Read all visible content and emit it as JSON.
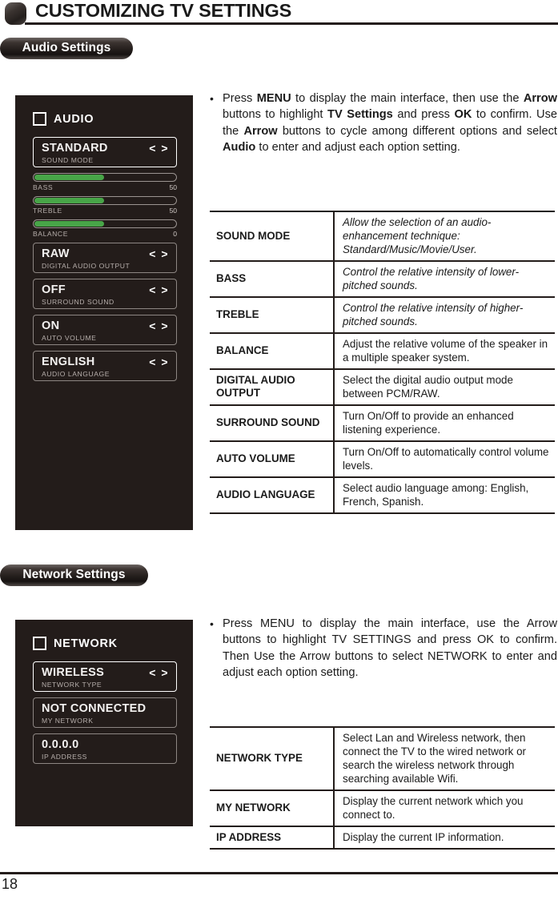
{
  "page": {
    "title": "CUSTOMIZING TV SETTINGS",
    "number": "18",
    "header_icon": "rounded-square-bullet-icon"
  },
  "sections": [
    {
      "pill_label": "Audio Settings",
      "osd": {
        "header_label": "AUDIO",
        "header_icon": "checkbox-icon",
        "items": [
          {
            "value": "STANDARD",
            "caption": "SOUND MODE",
            "arrows": "< >",
            "selected": true
          },
          {
            "value": "RAW",
            "caption": "DIGITAL AUDIO OUTPUT",
            "arrows": "< >",
            "selected": false
          },
          {
            "value": "OFF",
            "caption": "SURROUND SOUND",
            "arrows": "< >",
            "selected": false
          },
          {
            "value": "ON",
            "caption": "AUTO VOLUME",
            "arrows": "< >",
            "selected": false
          },
          {
            "value": "ENGLISH",
            "caption": "AUDIO LANGUAGE",
            "arrows": "< >",
            "selected": false
          }
        ],
        "sliders": [
          {
            "name": "BASS",
            "value": "50",
            "fill_percent": 50
          },
          {
            "name": "TREBLE",
            "value": "50",
            "fill_percent": 50
          },
          {
            "name": "BALANCE",
            "value": "0",
            "fill_percent": 50
          }
        ]
      },
      "instruction": {
        "bullet": "•",
        "runs": [
          {
            "t": "Press ",
            "b": false
          },
          {
            "t": "MENU",
            "b": true
          },
          {
            "t": " to display the main interface, then use the ",
            "b": false
          },
          {
            "t": "Arrow",
            "b": true
          },
          {
            "t": " buttons to highlight ",
            "b": false
          },
          {
            "t": "TV Settings",
            "b": true
          },
          {
            "t": " and press ",
            "b": false
          },
          {
            "t": "OK",
            "b": true
          },
          {
            "t": " to confirm. Use the ",
            "b": false
          },
          {
            "t": "Arrow",
            "b": true
          },
          {
            "t": " buttons to cycle among different options and select ",
            "b": false
          },
          {
            "t": "Audio",
            "b": true
          },
          {
            "t": " to enter and adjust each option setting.",
            "b": false
          }
        ]
      },
      "table": [
        {
          "key": "SOUND MODE",
          "desc": "Allow the selection of an audio-enhancement technique: Standard/Music/Movie/User.",
          "italic": true
        },
        {
          "key": "BASS",
          "desc": "Control the relative intensity of lower-pitched sounds.",
          "italic": true
        },
        {
          "key": "TREBLE",
          "desc": "Control the relative intensity of higher-pitched sounds.",
          "italic": true
        },
        {
          "key": "BALANCE",
          "desc": "Adjust the relative volume of the speaker in a multiple speaker system.",
          "italic": false
        },
        {
          "key": "DIGITAL AUDIO OUTPUT",
          "desc": "Select the digital audio output mode between PCM/RAW.",
          "italic": false
        },
        {
          "key": "SURROUND SOUND",
          "desc": "Turn On/Off to provide an enhanced listening experience.",
          "italic": false
        },
        {
          "key": "AUTO VOLUME",
          "desc": "Turn On/Off to automatically control volume levels.",
          "italic": false
        },
        {
          "key": "AUDIO LANGUAGE",
          "desc": "Select audio language among: English, French, Spanish.",
          "italic": false
        }
      ]
    },
    {
      "pill_label": "Network Settings",
      "osd": {
        "header_label": "NETWORK",
        "header_icon": "checkbox-icon",
        "items": [
          {
            "value": "WIRELESS",
            "caption": "NETWORK TYPE",
            "arrows": "< >",
            "selected": true
          },
          {
            "value": "NOT CONNECTED",
            "caption": "MY NETWORK",
            "arrows": "",
            "selected": false
          },
          {
            "value": "0.0.0.0",
            "caption": "IP ADDRESS",
            "arrows": "",
            "selected": false
          }
        ],
        "sliders": []
      },
      "instruction": {
        "bullet": "•",
        "runs": [
          {
            "t": "Press MENU to display the main interface, use the Arrow buttons to highlight TV SETTINGS and press OK to confirm. Then Use the Arrow buttons to select NETWORK to enter and adjust each option setting.",
            "b": false
          }
        ]
      },
      "table": [
        {
          "key": "NETWORK TYPE",
          "desc": "Select Lan and Wireless network, then connect the TV to the wired network or search the wireless network through searching available Wifi.",
          "italic": false
        },
        {
          "key": "MY NETWORK",
          "desc": "Display the current network which you connect to.",
          "italic": false
        },
        {
          "key": "IP ADDRESS",
          "desc": "Display the current IP information.",
          "italic": false
        }
      ]
    }
  ],
  "colors": {
    "osd_background": "#231c1a",
    "slider_green": "#48a548",
    "ink": "#231c1a",
    "selected_border": "#ffffff",
    "unselected_border": "#8d8683"
  }
}
